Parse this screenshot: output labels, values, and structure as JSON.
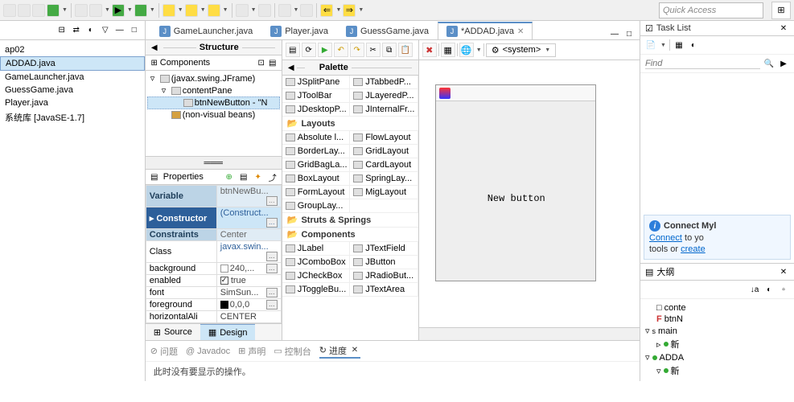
{
  "quick_access": "Quick Access",
  "left_panel": {
    "items": [
      "ap02",
      "ADDAD.java",
      "GameLauncher.java",
      "GuessGame.java",
      "Player.java",
      "系统库 [JavaSE-1.7]"
    ],
    "selected": 1
  },
  "editor_tabs": [
    {
      "label": "GameLauncher.java"
    },
    {
      "label": "Player.java"
    },
    {
      "label": "GuessGame.java"
    },
    {
      "label": "*ADDAD.java",
      "active": true
    }
  ],
  "structure": {
    "title": "Structure",
    "components_label": "Components",
    "tree": [
      {
        "indent": 0,
        "exp": "▿",
        "icon": "frame",
        "label": "(javax.swing.JFrame)"
      },
      {
        "indent": 1,
        "exp": "▿",
        "icon": "pane",
        "label": "contentPane"
      },
      {
        "indent": 2,
        "exp": "",
        "icon": "btn",
        "label": "btnNewButton - \"N",
        "selected": true
      },
      {
        "indent": 1,
        "exp": "",
        "icon": "folder",
        "label": "(non-visual beans)"
      }
    ]
  },
  "properties": {
    "label": "Properties",
    "rows": [
      {
        "name": "Variable",
        "value": "btnNewBu...",
        "header": true,
        "btn": true
      },
      {
        "name": "Constructor",
        "value": "(Construct...",
        "selected": true,
        "btn": true
      },
      {
        "name": "Constraints",
        "value": "Center",
        "header": true
      },
      {
        "name": "Class",
        "value": "javax.swin...",
        "blue": true,
        "btn": true
      },
      {
        "name": "background",
        "value": "240,...",
        "swatch": "white",
        "btn": true
      },
      {
        "name": "enabled",
        "value": "true",
        "check": true
      },
      {
        "name": "font",
        "value": "SimSun...",
        "btn": true
      },
      {
        "name": "foreground",
        "value": "0,0,0",
        "swatch": "black",
        "btn": true
      },
      {
        "name": "horizontalAli",
        "value": "CENTER"
      }
    ]
  },
  "bottom_tabs": {
    "source": "Source",
    "design": "Design"
  },
  "palette": {
    "title": "Palette",
    "top_row": [
      "JSplitPane",
      "JTabbedP..."
    ],
    "containers": [
      "JToolBar",
      "JLayeredP...",
      "JDesktopP...",
      "JInternalFr..."
    ],
    "layouts_label": "Layouts",
    "layouts": [
      "Absolute l...",
      "FlowLayout",
      "BorderLay...",
      "GridLayout",
      "GridBagLa...",
      "CardLayout",
      "BoxLayout",
      "SpringLay...",
      "FormLayout",
      "MigLayout",
      "GroupLay...",
      ""
    ],
    "struts_label": "Struts & Springs",
    "components_label": "Components",
    "components": [
      "JLabel",
      "JTextField",
      "JComboBox",
      "JButton",
      "JCheckBox",
      "JRadioBut...",
      "JToggleBu...",
      "JTextArea"
    ]
  },
  "design_toolbar": {
    "system": "<system>"
  },
  "canvas_button": "New button",
  "task_list": {
    "title": "Task List",
    "find": "Find"
  },
  "connect": {
    "title": "Connect Myl",
    "line1a": "Connect",
    "line1b": " to yo",
    "line2a": "tools or ",
    "line2b": "create"
  },
  "outline": {
    "title": "大纲",
    "rows": [
      {
        "indent": 1,
        "sym": "□",
        "label": "conte"
      },
      {
        "indent": 1,
        "sym": "F",
        "color": "red",
        "label": "btnN"
      },
      {
        "indent": 0,
        "sym": "▿",
        "label": "main",
        "prefix": "s"
      },
      {
        "indent": 1,
        "sym": "▹",
        "dot": "green",
        "label": "新"
      },
      {
        "indent": 0,
        "sym": "▿",
        "dot": "green",
        "label": "ADDA"
      },
      {
        "indent": 1,
        "sym": "▿",
        "dot": "green",
        "label": "新"
      }
    ]
  },
  "bottom_views": {
    "problems": "问题",
    "javadoc": "Javadoc",
    "declaration": "声明",
    "console": "控制台",
    "progress": "进度"
  },
  "bottom_message": "此时没有要显示的操作。"
}
